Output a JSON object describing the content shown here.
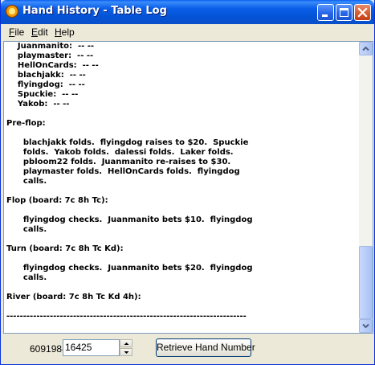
{
  "window": {
    "title": "Hand History - Table Log"
  },
  "menu": {
    "file": {
      "accel": "F",
      "rest": "ile"
    },
    "edit": {
      "accel": "E",
      "rest": "dit"
    },
    "help": {
      "accel": "H",
      "rest": "elp"
    }
  },
  "log": {
    "text": "    Juanmanito:  -- --\n    playmaster:  -- --\n    HellOnCards:  -- --\n    blachjakk:  -- --\n    flyingdog:  -- --\n    Spuckie:  -- --\n    Yakob:  -- --\n\nPre-flop:\n\n      blachjakk folds.  flyingdog raises to $20.  Spuckie\n      folds.  Yakob folds.  dalessi folds.  Laker folds.\n      pbloom22 folds.  Juanmanito re-raises to $30.\n      playmaster folds.  HellOnCards folds.  flyingdog\n      calls.\n\nFlop (board: 7c 8h Tc):\n\n      flyingdog checks.  Juanmanito bets $10.  flyingdog\n      calls.\n\nTurn (board: 7c 8h Tc Kd):\n\n      flyingdog checks.  Juanmanito bets $20.  flyingdog\n      calls.\n\nRiver (board: 7c 8h Tc Kd 4h):\n\n------------------------------------------------------------------------"
  },
  "hand_lookup": {
    "prefix": "609198-",
    "value": "16425",
    "button_label": "Retrieve Hand Number"
  }
}
